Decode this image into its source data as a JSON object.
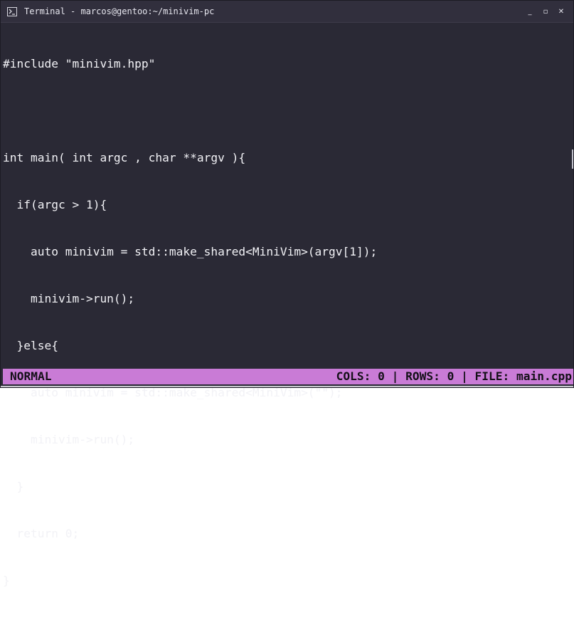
{
  "window": {
    "title": "Terminal - marcos@gentoo:~/minivim-pc",
    "controls": {
      "minimize": "_",
      "maximize": "▫",
      "close": "✕"
    },
    "icon": "terminal-icon"
  },
  "editor": {
    "lines": [
      "#include \"minivim.hpp\"",
      "",
      "int main( int argc , char **argv ){",
      "  if(argc > 1){",
      "    auto minivim = std::make_shared<MiniVim>(argv[1]);",
      "    minivim->run();",
      "  }else{",
      "    auto minivim = std::make_shared<MiniVim>(\"\");",
      "    minivim->run();",
      "  }",
      "  return 0;",
      "}"
    ]
  },
  "statusbar": {
    "mode": "NORMAL",
    "info": "COLS: 0 | ROWS: 0 | FILE: main.cpp"
  },
  "colors": {
    "background": "#2a2935",
    "statusbar": "#c97bd6",
    "text": "#f2f2f6"
  }
}
